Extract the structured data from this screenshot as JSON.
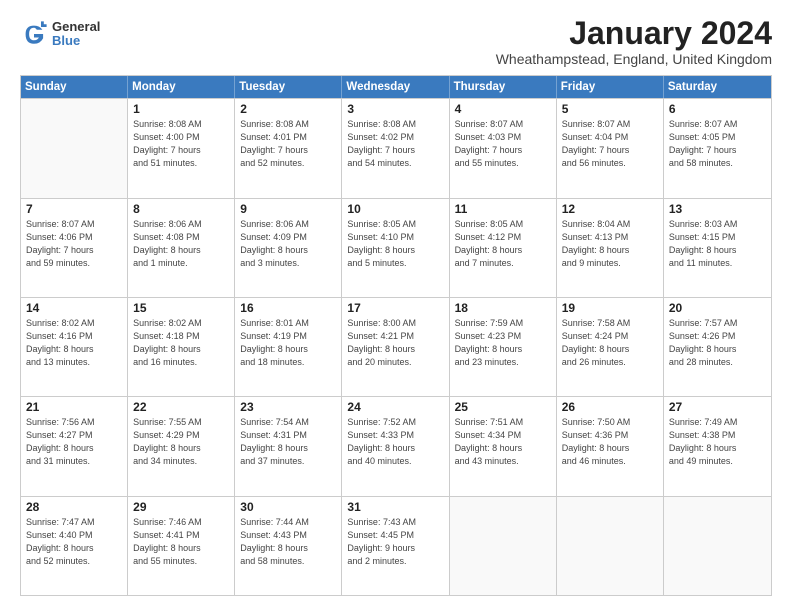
{
  "logo": {
    "general": "General",
    "blue": "Blue"
  },
  "title": "January 2024",
  "location": "Wheathampstead, England, United Kingdom",
  "header_days": [
    "Sunday",
    "Monday",
    "Tuesday",
    "Wednesday",
    "Thursday",
    "Friday",
    "Saturday"
  ],
  "weeks": [
    [
      {
        "day": "",
        "info": ""
      },
      {
        "day": "1",
        "info": "Sunrise: 8:08 AM\nSunset: 4:00 PM\nDaylight: 7 hours\nand 51 minutes."
      },
      {
        "day": "2",
        "info": "Sunrise: 8:08 AM\nSunset: 4:01 PM\nDaylight: 7 hours\nand 52 minutes."
      },
      {
        "day": "3",
        "info": "Sunrise: 8:08 AM\nSunset: 4:02 PM\nDaylight: 7 hours\nand 54 minutes."
      },
      {
        "day": "4",
        "info": "Sunrise: 8:07 AM\nSunset: 4:03 PM\nDaylight: 7 hours\nand 55 minutes."
      },
      {
        "day": "5",
        "info": "Sunrise: 8:07 AM\nSunset: 4:04 PM\nDaylight: 7 hours\nand 56 minutes."
      },
      {
        "day": "6",
        "info": "Sunrise: 8:07 AM\nSunset: 4:05 PM\nDaylight: 7 hours\nand 58 minutes."
      }
    ],
    [
      {
        "day": "7",
        "info": "Sunrise: 8:07 AM\nSunset: 4:06 PM\nDaylight: 7 hours\nand 59 minutes."
      },
      {
        "day": "8",
        "info": "Sunrise: 8:06 AM\nSunset: 4:08 PM\nDaylight: 8 hours\nand 1 minute."
      },
      {
        "day": "9",
        "info": "Sunrise: 8:06 AM\nSunset: 4:09 PM\nDaylight: 8 hours\nand 3 minutes."
      },
      {
        "day": "10",
        "info": "Sunrise: 8:05 AM\nSunset: 4:10 PM\nDaylight: 8 hours\nand 5 minutes."
      },
      {
        "day": "11",
        "info": "Sunrise: 8:05 AM\nSunset: 4:12 PM\nDaylight: 8 hours\nand 7 minutes."
      },
      {
        "day": "12",
        "info": "Sunrise: 8:04 AM\nSunset: 4:13 PM\nDaylight: 8 hours\nand 9 minutes."
      },
      {
        "day": "13",
        "info": "Sunrise: 8:03 AM\nSunset: 4:15 PM\nDaylight: 8 hours\nand 11 minutes."
      }
    ],
    [
      {
        "day": "14",
        "info": "Sunrise: 8:02 AM\nSunset: 4:16 PM\nDaylight: 8 hours\nand 13 minutes."
      },
      {
        "day": "15",
        "info": "Sunrise: 8:02 AM\nSunset: 4:18 PM\nDaylight: 8 hours\nand 16 minutes."
      },
      {
        "day": "16",
        "info": "Sunrise: 8:01 AM\nSunset: 4:19 PM\nDaylight: 8 hours\nand 18 minutes."
      },
      {
        "day": "17",
        "info": "Sunrise: 8:00 AM\nSunset: 4:21 PM\nDaylight: 8 hours\nand 20 minutes."
      },
      {
        "day": "18",
        "info": "Sunrise: 7:59 AM\nSunset: 4:23 PM\nDaylight: 8 hours\nand 23 minutes."
      },
      {
        "day": "19",
        "info": "Sunrise: 7:58 AM\nSunset: 4:24 PM\nDaylight: 8 hours\nand 26 minutes."
      },
      {
        "day": "20",
        "info": "Sunrise: 7:57 AM\nSunset: 4:26 PM\nDaylight: 8 hours\nand 28 minutes."
      }
    ],
    [
      {
        "day": "21",
        "info": "Sunrise: 7:56 AM\nSunset: 4:27 PM\nDaylight: 8 hours\nand 31 minutes."
      },
      {
        "day": "22",
        "info": "Sunrise: 7:55 AM\nSunset: 4:29 PM\nDaylight: 8 hours\nand 34 minutes."
      },
      {
        "day": "23",
        "info": "Sunrise: 7:54 AM\nSunset: 4:31 PM\nDaylight: 8 hours\nand 37 minutes."
      },
      {
        "day": "24",
        "info": "Sunrise: 7:52 AM\nSunset: 4:33 PM\nDaylight: 8 hours\nand 40 minutes."
      },
      {
        "day": "25",
        "info": "Sunrise: 7:51 AM\nSunset: 4:34 PM\nDaylight: 8 hours\nand 43 minutes."
      },
      {
        "day": "26",
        "info": "Sunrise: 7:50 AM\nSunset: 4:36 PM\nDaylight: 8 hours\nand 46 minutes."
      },
      {
        "day": "27",
        "info": "Sunrise: 7:49 AM\nSunset: 4:38 PM\nDaylight: 8 hours\nand 49 minutes."
      }
    ],
    [
      {
        "day": "28",
        "info": "Sunrise: 7:47 AM\nSunset: 4:40 PM\nDaylight: 8 hours\nand 52 minutes."
      },
      {
        "day": "29",
        "info": "Sunrise: 7:46 AM\nSunset: 4:41 PM\nDaylight: 8 hours\nand 55 minutes."
      },
      {
        "day": "30",
        "info": "Sunrise: 7:44 AM\nSunset: 4:43 PM\nDaylight: 8 hours\nand 58 minutes."
      },
      {
        "day": "31",
        "info": "Sunrise: 7:43 AM\nSunset: 4:45 PM\nDaylight: 9 hours\nand 2 minutes."
      },
      {
        "day": "",
        "info": ""
      },
      {
        "day": "",
        "info": ""
      },
      {
        "day": "",
        "info": ""
      }
    ]
  ]
}
